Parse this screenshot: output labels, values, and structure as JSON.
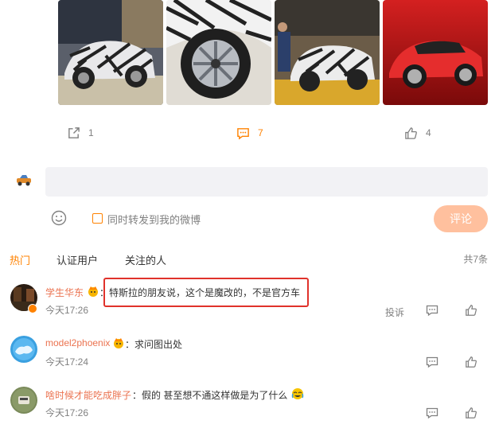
{
  "actions": {
    "repost_count": "1",
    "comment_count": "7",
    "like_count": "4"
  },
  "composer": {
    "repost_label": "同时转发到我的微博",
    "submit_label": "评论"
  },
  "tabs": [
    "热门",
    "认证用户",
    "关注的人"
  ],
  "total_label": "共7条",
  "comments": [
    {
      "name": "学生华东",
      "text": "特斯拉的朋友说，这个是魔改的，不是官方车",
      "time": "今天17:26",
      "report_label": "投诉"
    },
    {
      "name": "model2phoenix",
      "text": "求问图出处",
      "time": "今天17:24"
    },
    {
      "name": "啥时候才能吃成胖子",
      "text": "假的 甚至想不通这样做是为了什么",
      "time": "今天17:26"
    }
  ],
  "colors": {
    "accent": "#ff8200",
    "name_link": "#eb7350",
    "submit_disabled": "#ffc09e",
    "highlight_box": "#e0322b"
  }
}
